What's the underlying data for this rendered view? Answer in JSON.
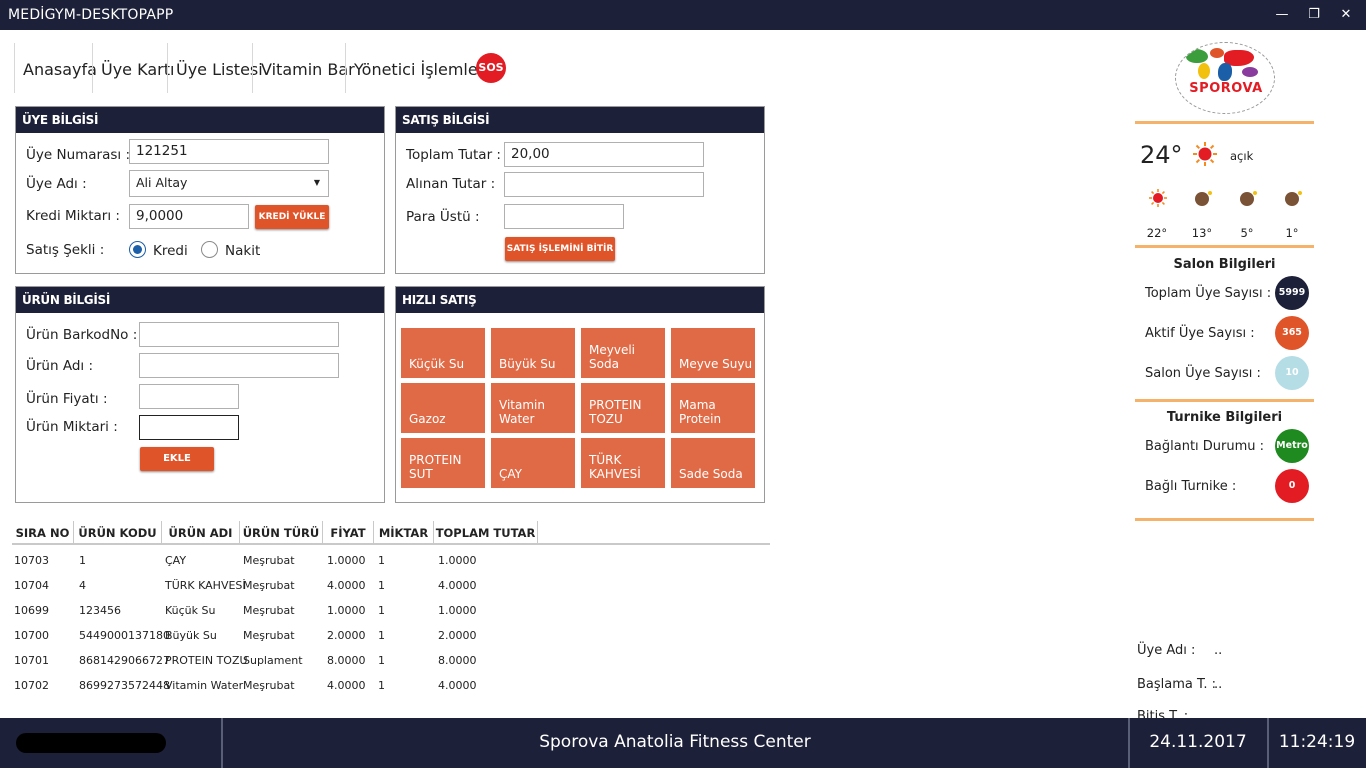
{
  "app": {
    "title": "MEDİGYM-DESKTOPAPP"
  },
  "nav": {
    "items": [
      {
        "label": "Anasayfa"
      },
      {
        "label": "Üye Kartı"
      },
      {
        "label": "Üye Listesi"
      },
      {
        "label": "Vitamin Bar"
      },
      {
        "label": "Yönetici İşlemleri"
      }
    ],
    "sos_label": "SOS"
  },
  "uye_bilgisi": {
    "header": "ÜYE BİLGİSİ",
    "uye_numarasi_label": "Üye Numarası :",
    "uye_numarasi_value": "121251",
    "uye_adi_label": "Üye Adı :",
    "uye_adi_value": "Ali Altay",
    "kredi_miktari_label": "Kredi Miktarı :",
    "kredi_miktari_value": "9,0000",
    "kredi_yukle_button": "KREDİ YÜKLE",
    "satis_sekli_label": "Satış Şekli :",
    "option_kredi": "Kredi",
    "option_nakit": "Nakit",
    "selected_option": "Kredi"
  },
  "satis_bilgisi": {
    "header": "SATIŞ BİLGİSİ",
    "toplam_tutar_label": "Toplam Tutar :",
    "toplam_tutar_value": "20,00",
    "alinan_tutar_label": "Alınan Tutar :",
    "alinan_tutar_value": "",
    "para_ustu_label": "Para Üstü :",
    "para_ustu_value": "",
    "bitir_button": "SATIŞ İŞLEMİNİ BİTİR"
  },
  "urun_bilgisi": {
    "header": "ÜRÜN BİLGİSİ",
    "barkod_label": "Ürün BarkodNo :",
    "adi_label": "Ürün Adı :",
    "fiyat_label": "Ürün Fiyatı :",
    "miktar_label": "Ürün Miktari :",
    "ekle_button": "EKLE"
  },
  "hizli_satis": {
    "header": "HIZLI SATIŞ",
    "tiles": [
      [
        "Küçük Su"
      ],
      [
        "Büyük Su"
      ],
      [
        "Meyveli",
        "Soda"
      ],
      [
        "Meyve Suyu"
      ],
      [
        "Gazoz"
      ],
      [
        "Vitamin",
        "Water"
      ],
      [
        "PROTEIN",
        "TOZU"
      ],
      [
        "Mama",
        "Protein"
      ],
      [
        "PROTEIN",
        "SUT"
      ],
      [
        "ÇAY"
      ],
      [
        "TÜRK",
        "KAHVESİ"
      ],
      [
        "Sade Soda"
      ]
    ]
  },
  "table": {
    "columns": [
      "SIRA NO",
      "ÜRÜN KODU",
      "ÜRÜN ADI",
      "ÜRÜN TÜRÜ",
      "FİYAT",
      "MİKTAR",
      "TOPLAM TUTAR"
    ],
    "rows": [
      [
        "10703",
        "1",
        "ÇAY",
        "Meşrubat",
        "1.0000",
        "1",
        "1.0000"
      ],
      [
        "10704",
        "4",
        "TÜRK KAHVESİ",
        "Meşrubat",
        "4.0000",
        "1",
        "4.0000"
      ],
      [
        "10699",
        "123456",
        "Küçük Su",
        "Meşrubat",
        "1.0000",
        "1",
        "1.0000"
      ],
      [
        "10700",
        "5449000137180",
        "Büyük Su",
        "Meşrubat",
        "2.0000",
        "1",
        "2.0000"
      ],
      [
        "10701",
        "8681429066727",
        "PROTEIN TOZU",
        "Suplament",
        "8.0000",
        "1",
        "8.0000"
      ],
      [
        "10702",
        "8699273572448",
        "Vitamin Water",
        "Meşrubat",
        "4.0000",
        "1",
        "4.0000"
      ]
    ]
  },
  "brand": {
    "logo_text": "SPOROVA"
  },
  "weather": {
    "current_temp": "24°",
    "current_desc": "açık",
    "forecast": [
      "22°",
      "13°",
      "5°",
      "1°"
    ]
  },
  "salon": {
    "header": "Salon Bilgileri",
    "toplam_label": "Toplam Üye Sayısı :",
    "toplam_value": "5999",
    "aktif_label": "Aktif Üye Sayısı :",
    "aktif_value": "365",
    "salon_label": "Salon Üye Sayısı :",
    "salon_value": "10"
  },
  "turnike": {
    "header": "Turnike Bilgileri",
    "baglanti_label": "Bağlantı Durumu :",
    "baglanti_value": "Metro",
    "bagli_label": "Bağlı Turnike :",
    "bagli_value": "0"
  },
  "member_info": {
    "uye_adi_label": "Üye Adı :",
    "uye_adi_value": "..",
    "baslama_label": "Başlama T. :",
    "baslama_value": "..",
    "bitis_label": "Bitiş T. :"
  },
  "taskbar": {
    "center_text": "Sporova Anatolia Fitness Center",
    "date": "24.11.2017",
    "time": "11:24:19"
  },
  "colors": {
    "navy": "#1c2038",
    "orange": "#e0542a",
    "tile": "#e06a45",
    "red": "#e31b23",
    "green": "#1f8a1f",
    "light_blue": "#b5dde6"
  }
}
